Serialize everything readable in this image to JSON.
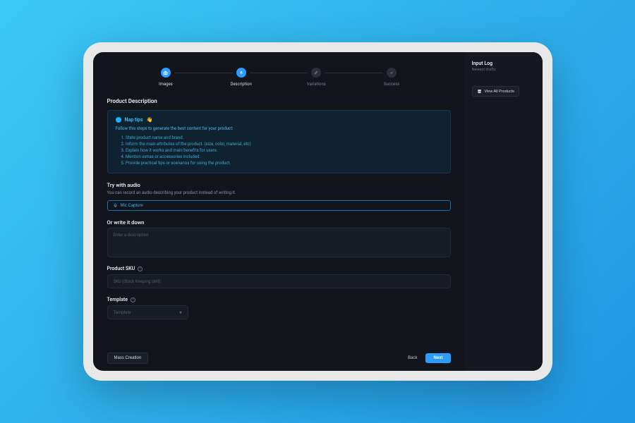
{
  "stepper": {
    "steps": [
      {
        "label": "Images"
      },
      {
        "label": "Description"
      },
      {
        "label": "Variations"
      },
      {
        "label": "Success"
      }
    ]
  },
  "page_title": "Product Description",
  "tips": {
    "title": "Nap tips",
    "emoji": "👋",
    "subtitle": "Follow this steps to generate the best content for your product:",
    "items": [
      "1. State product name and brand.",
      "2. Inform the main attributes of the product. (size, color, material, etc)",
      "3. Explain how it works and main benefits for users.",
      "4. Mention extras or accessories included.",
      "5. Provide practical tips or scenarios for using the product."
    ]
  },
  "audio": {
    "title": "Try with audio",
    "desc": "You can record an audio describing your product instead of writing it.",
    "button": "Mic Capture"
  },
  "write": {
    "title": "Or write it down",
    "placeholder": "Enter a description"
  },
  "sku": {
    "label": "Product SKU",
    "placeholder": "SKU (Stock Keeping Unit)"
  },
  "template": {
    "label": "Template",
    "placeholder": "Template"
  },
  "footer": {
    "mass": "Mass Creation",
    "back": "Back",
    "next": "Next"
  },
  "sidebar": {
    "title": "Input Log",
    "subtitle": "Newest drafts",
    "view_all": "View All Products"
  }
}
